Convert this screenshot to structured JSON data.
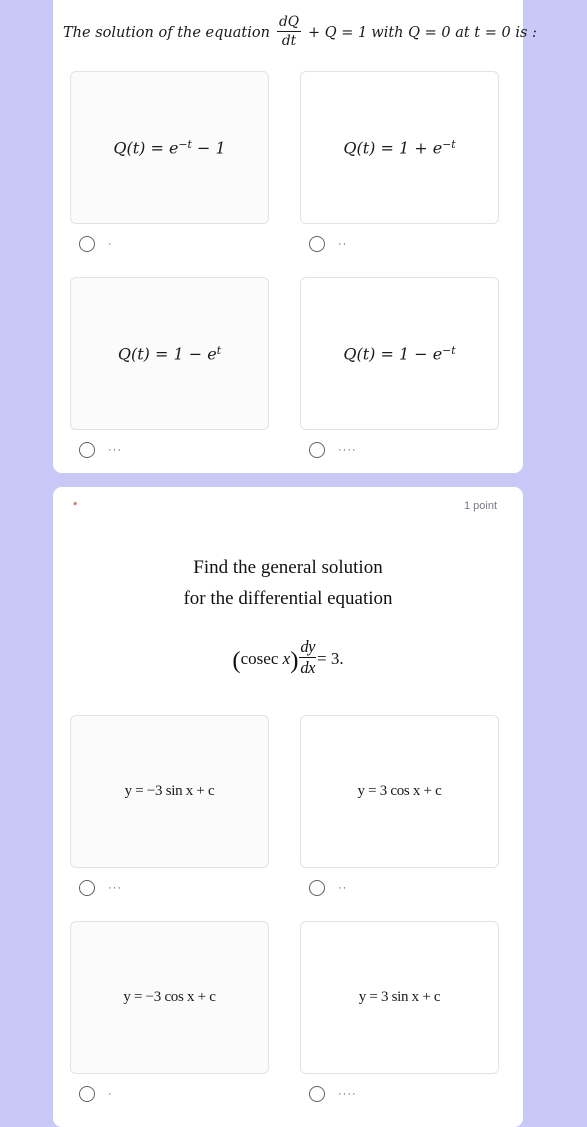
{
  "theme": {
    "page_background": "#c9c9f7",
    "card_background": "#ffffff",
    "option_box_background": "#fbfbfb",
    "option_box_border": "#e3e3e6",
    "radio_border": "#5f6368",
    "required_asterisk_color": "#c0392b",
    "point_text_color": "#7a7a85"
  },
  "question1": {
    "prompt": {
      "segment_1": "The solution of the equation",
      "fraction_numerator": "dQ",
      "fraction_denominator": "dt",
      "segment_2": "+ Q = 1",
      "segment_3": "with Q = 0 at t = 0 is :",
      "plain_text": "The solution of the equation dQ/dt + Q = 1 with Q = 0 at t = 0 is :"
    },
    "options": [
      {
        "lhs": "Q(t) = e",
        "exponent": "−t",
        "rhs": " − 1",
        "plain_text": "Q(t) = e^(-t) - 1",
        "label_dots": "·",
        "selected": false
      },
      {
        "lhs": "Q(t) = 1 + e",
        "exponent": "−t",
        "rhs": "",
        "plain_text": "Q(t) = 1 + e^(-t)",
        "label_dots": "··",
        "selected": false
      },
      {
        "lhs": "Q(t) = 1 − e",
        "exponent": "t",
        "rhs": "",
        "plain_text": "Q(t) = 1 - e^t",
        "label_dots": "···",
        "selected": false
      },
      {
        "lhs": "Q(t) = 1 − e",
        "exponent": "−t",
        "rhs": "",
        "plain_text": "Q(t) = 1 - e^(-t)",
        "label_dots": "····",
        "selected": false
      }
    ]
  },
  "question2": {
    "required_marker": "*",
    "point_value": "1 point",
    "prompt": {
      "line_1": "Find the general solution",
      "line_2": "for the differential equation",
      "equation_open_paren": "(",
      "equation_cosec": "cosec ",
      "equation_variable": "x",
      "equation_close_paren": ")",
      "fraction_numerator": "dy",
      "fraction_denominator": "dx",
      "equation_result": "= 3",
      "equation_period": ".",
      "plain_text": "Find the general solution for the differential equation (cosec x) dy/dx = 3."
    },
    "options": [
      {
        "text": "y = −3 sin x + c",
        "plain_text": "y = -3 sin x + c",
        "label_dots": "···",
        "selected": false
      },
      {
        "text": "y = 3 cos x + c",
        "plain_text": "y = 3 cos x + c",
        "label_dots": "··",
        "selected": false
      },
      {
        "text": "y = −3 cos x + c",
        "plain_text": "y = -3 cos x + c",
        "label_dots": "·",
        "selected": false
      },
      {
        "text": "y = 3 sin x + c",
        "plain_text": "y = 3 sin x + c",
        "label_dots": "····",
        "selected": false
      }
    ]
  }
}
